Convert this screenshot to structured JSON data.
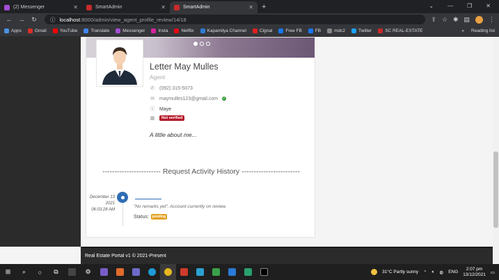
{
  "browser": {
    "tabs": [
      {
        "label": "(2) Messenger",
        "color": "#a34dd6",
        "active": false
      },
      {
        "label": "SmartAdmin",
        "color": "#c92a2a",
        "active": false
      },
      {
        "label": "SmartAdmin",
        "color": "#c92a2a",
        "active": true
      }
    ],
    "new_tab": "+",
    "url_host": "localhost",
    "url_path": ":8000/admin/view_agent_profile_review/14/18",
    "profile_initial": "I"
  },
  "bookmarks": [
    {
      "label": "Apps",
      "color": "#4a90e2"
    },
    {
      "label": "Gmail",
      "color": "#d93025"
    },
    {
      "label": "YouTube",
      "color": "#ff0000"
    },
    {
      "label": "Translate",
      "color": "#4285f4"
    },
    {
      "label": "Messenger",
      "color": "#a34dd6"
    },
    {
      "label": "Insta",
      "color": "#d6249f"
    },
    {
      "label": "Netflix",
      "color": "#e50914"
    },
    {
      "label": "Kapamilya Channel",
      "color": "#2e7dd7"
    },
    {
      "label": "Cignal",
      "color": "#e02020"
    },
    {
      "label": "Free FB",
      "color": "#1877f2"
    },
    {
      "label": "FB",
      "color": "#1877f2"
    },
    {
      "label": "mdc2",
      "color": "#888888"
    },
    {
      "label": "Twitter",
      "color": "#1da1f2"
    },
    {
      "label": "SC REAL-ESTATE",
      "color": "#c92a2a"
    }
  ],
  "bookmarks_more": "»",
  "reading_list": "Reading list",
  "profile": {
    "name": "Letter May Mulles",
    "role": "Agent",
    "phone": "(092) 315-5073",
    "email": "maymulles123@gmail.com",
    "skype": "Maye",
    "verification": "Not verified",
    "about": "A little about me..."
  },
  "history": {
    "title": "------------------------ Request Activity History ------------------------",
    "date_line1": "December 13",
    "date_line2": "2021",
    "time": "06:03:28 AM",
    "remark": "\"No remarks yet\". Account currently on review.",
    "status_label": "Status:",
    "status_value": "pending"
  },
  "footer": "Real Estate Portal v1 © 2021-Present",
  "taskbar": {
    "weather": "31°C  Partly sunny",
    "lang": "ENG",
    "time": "2:07 pm",
    "date": "13/12/2021"
  }
}
